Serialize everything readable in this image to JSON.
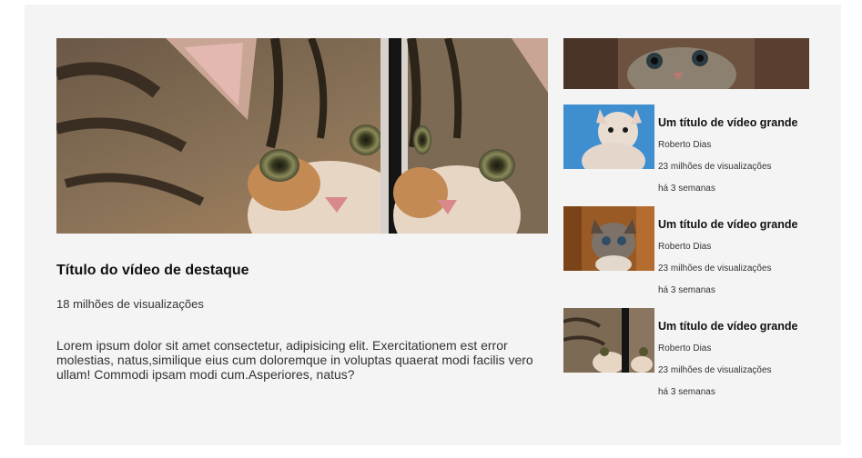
{
  "featured": {
    "title": "Título do vídeo de destaque",
    "views": "18 milhões de visualizações",
    "description": "Lorem ipsum dolor sit amet consectetur, adipisicing elit. Exercitationem est error molestias, natus,similique eius cum doloremque in voluptas quaerat modi facilis vero ullam! Commodi ipsam modi cum.Asperiores, natus?"
  },
  "sidebar": {
    "items": [
      {
        "title": "Um título de vídeo grande",
        "author": "Roberto Dias",
        "views": "23 milhões de visualizações",
        "age": "há 3 semanas"
      },
      {
        "title": "Um título de vídeo grande",
        "author": "Roberto Dias",
        "views": "23 milhões de visualizações",
        "age": "há 3 semanas"
      },
      {
        "title": "Um título de vídeo grande",
        "author": "Roberto Dias",
        "views": "23 milhões de visualizações",
        "age": "há 3 semanas"
      }
    ]
  },
  "colors": {
    "panel_background": "#f4f4f4",
    "text_primary": "#111111",
    "text_secondary": "#333333"
  }
}
